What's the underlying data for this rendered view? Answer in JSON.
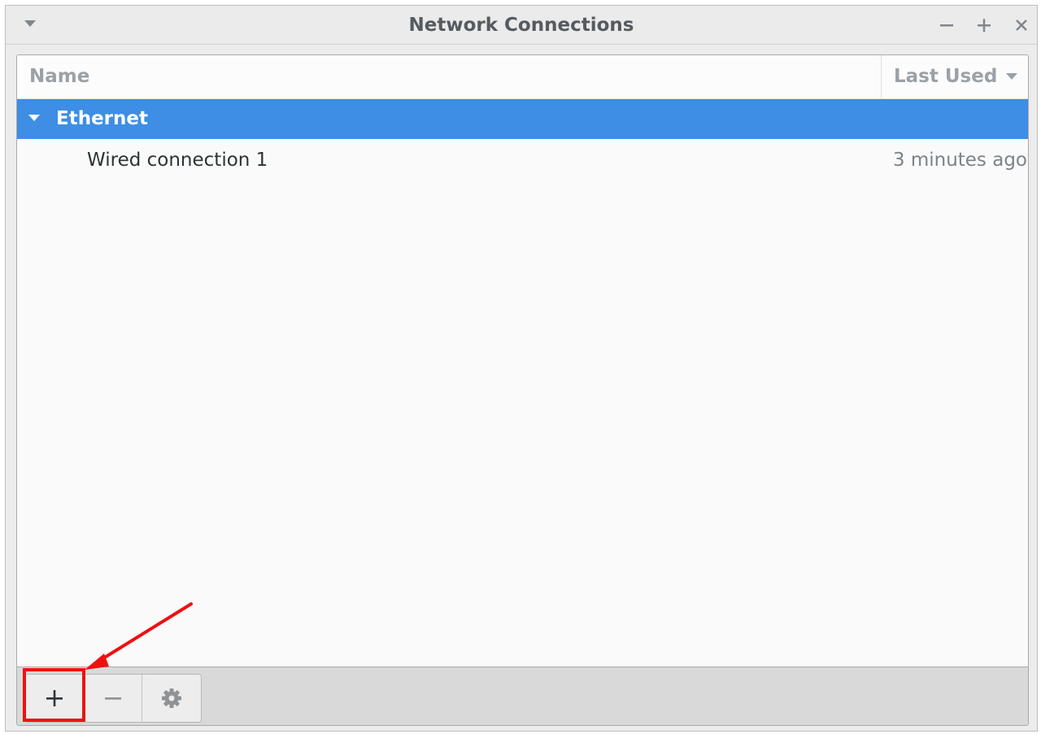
{
  "window": {
    "title": "Network Connections"
  },
  "columns": {
    "name": "Name",
    "last_used": "Last Used"
  },
  "groups": [
    {
      "label": "Ethernet",
      "expanded": true,
      "selected": true,
      "connections": [
        {
          "name": "Wired connection 1",
          "last_used": "3 minutes ago"
        }
      ]
    }
  ],
  "toolbar": {
    "add_icon": "plus-icon",
    "remove_icon": "minus-icon",
    "settings_icon": "gear-icon"
  },
  "colors": {
    "selection": "#3d8ee4",
    "annotation": "#ee1111"
  }
}
